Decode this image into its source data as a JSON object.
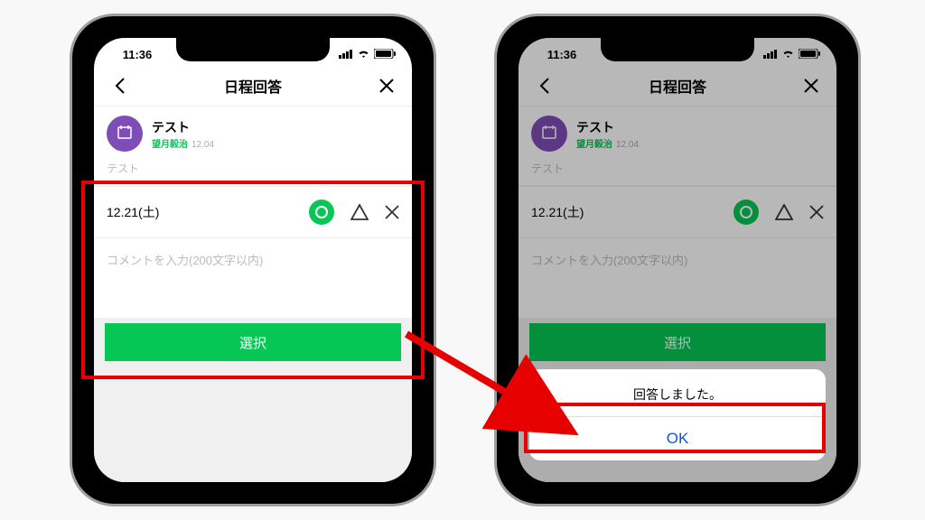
{
  "status": {
    "time": "11:36"
  },
  "header": {
    "title": "日程回答"
  },
  "event": {
    "title": "テスト",
    "organizer": "望月毅治",
    "created": "12.04",
    "note": "テスト"
  },
  "row": {
    "date": "12.21(土)"
  },
  "comment": {
    "placeholder": "コメントを入力(200文字以内)"
  },
  "actions": {
    "select": "選択"
  },
  "dialog": {
    "message": "回答しました。",
    "ok": "OK"
  },
  "colors": {
    "accent": "#06c755",
    "hl": "#e60000",
    "link": "#0a57d0",
    "avatar": "#7e4db7"
  }
}
